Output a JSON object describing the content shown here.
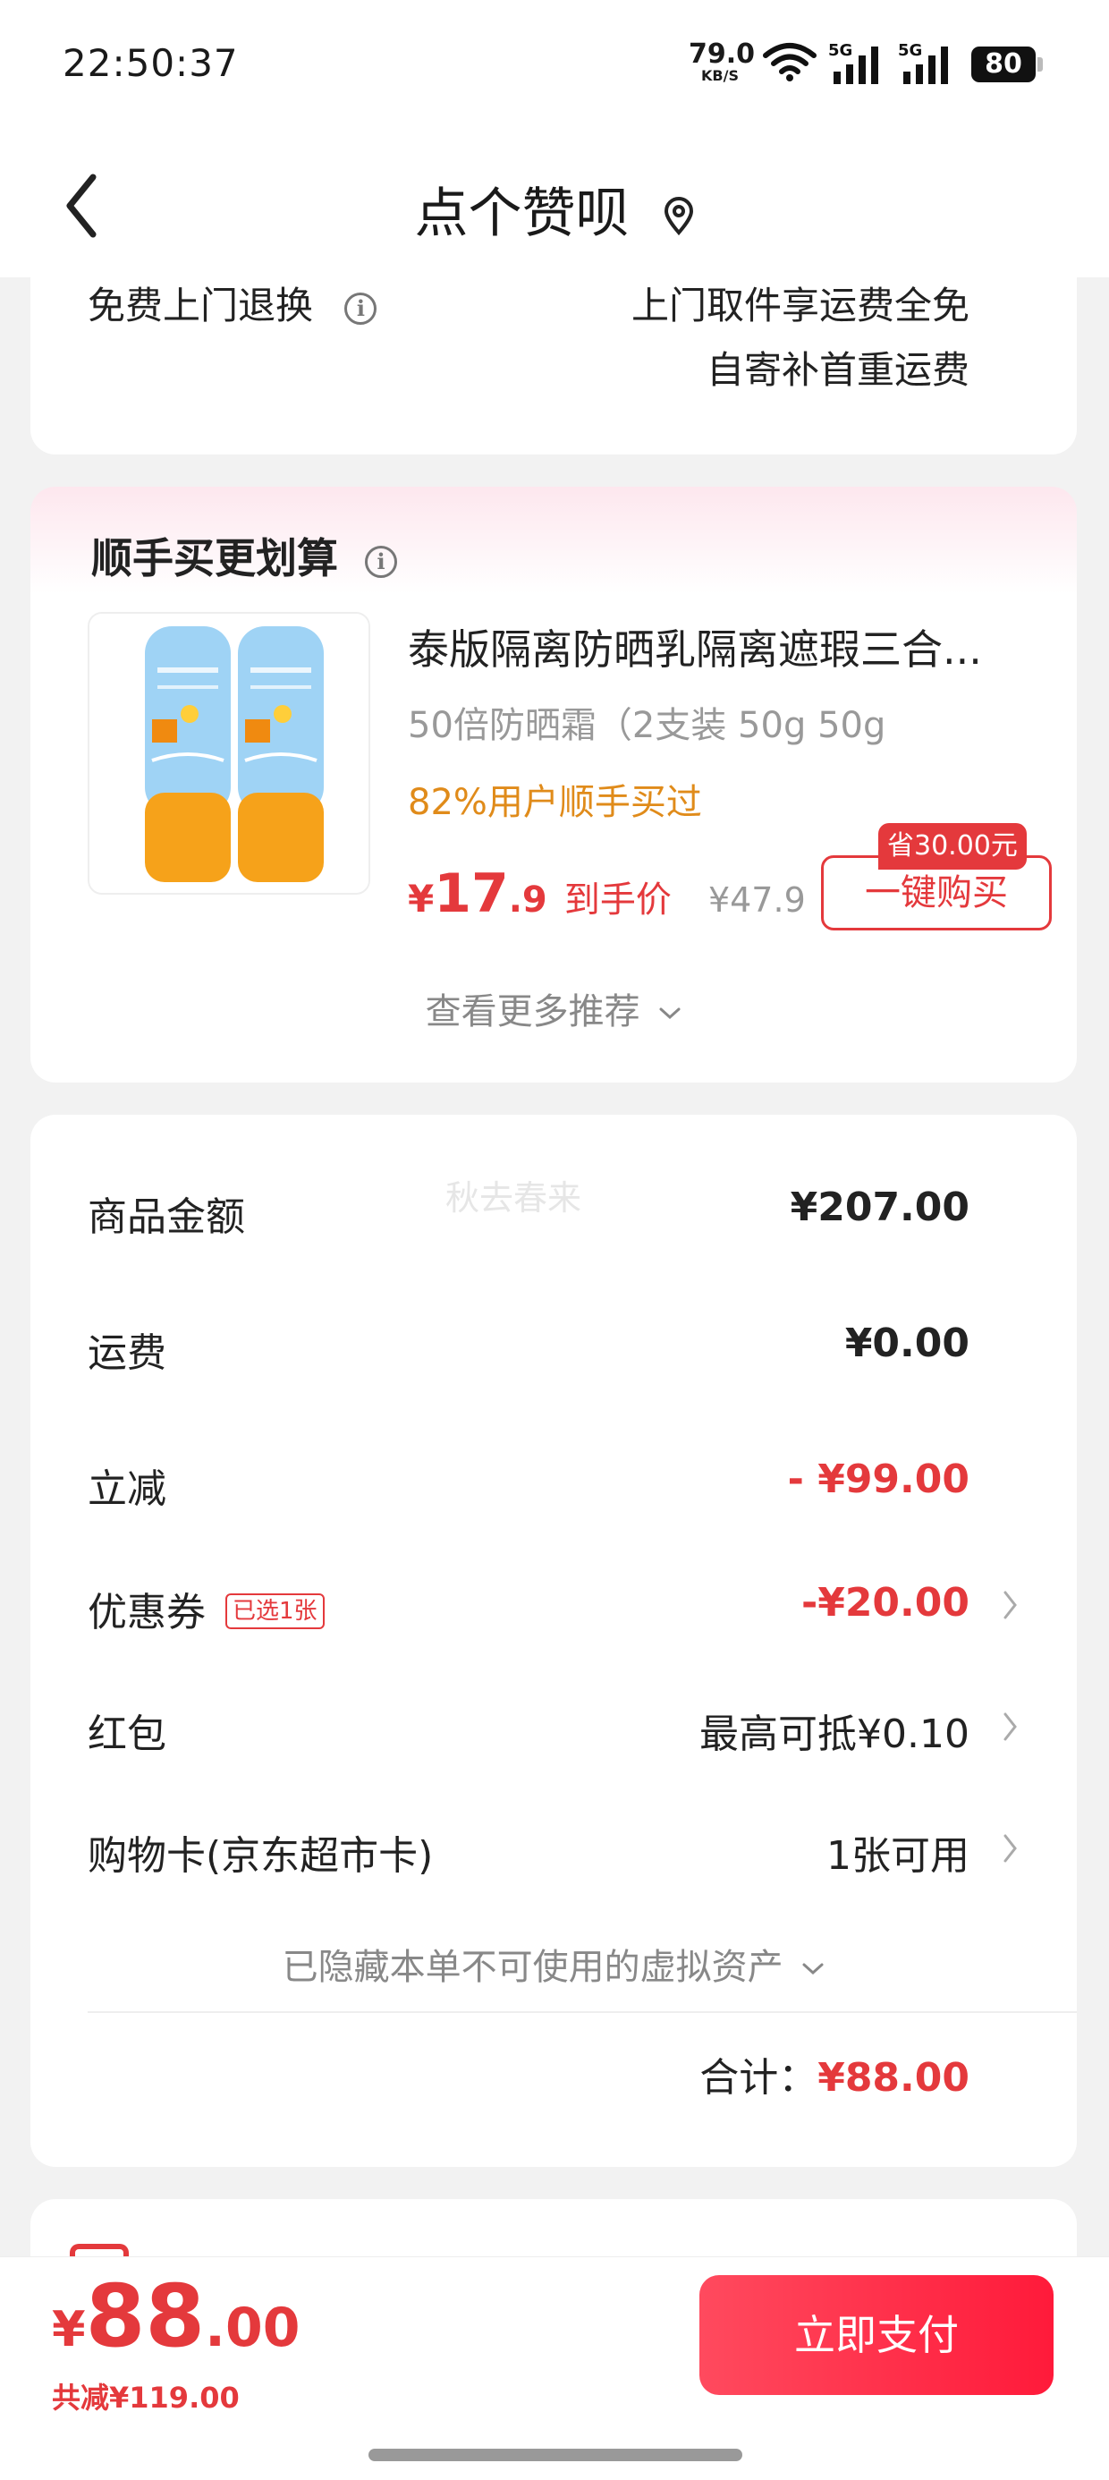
{
  "status": {
    "time": "22:50:37",
    "net_speed": "79.0",
    "net_unit": "KB/S",
    "battery": "80",
    "sig1": "5G",
    "sig2": "5G"
  },
  "nav": {
    "title": "点个赞呗"
  },
  "returns": {
    "label": "免费上门退换",
    "line1": "上门取件享运费全免",
    "line2": "自寄补首重运费"
  },
  "recommend": {
    "title": "顺手买更划算",
    "product": {
      "name": "泰版隔离防晒乳隔离遮瑕三合...",
      "spec": "50倍防晒霜（2支装 50g   50g",
      "buyers": "82%用户顺手买过",
      "price_yen": "¥",
      "price_int": "17",
      "price_dec": ".9",
      "price_tag": "到手价",
      "orig_price": "¥47.9",
      "save_badge": "省30.00元",
      "buy_label": "一键购买"
    },
    "more": "查看更多推荐"
  },
  "summary": {
    "watermark": "秋去春来",
    "rows": [
      {
        "label": "商品金额",
        "value": "¥207.00"
      },
      {
        "label": "运费",
        "value": "¥0.00"
      },
      {
        "label": "立减",
        "value": "- ¥99.00"
      },
      {
        "label": "优惠券",
        "pill": "已选1张",
        "value": "-¥20.00"
      },
      {
        "label": "红包",
        "value": "最高可抵¥0.10"
      },
      {
        "label": "购物卡(京东超市卡)",
        "value": "1张可用"
      }
    ],
    "hidden": "已隐藏本单不可使用的虚拟资产",
    "total_label": "合计：",
    "total_value": "¥88.00"
  },
  "bottom": {
    "yen": "¥",
    "int": "88",
    "dec": ".00",
    "saved": "共减¥119.00",
    "pay": "立即支付"
  },
  "colors": {
    "accent": "#e4393c",
    "orange": "#e08b1a"
  }
}
